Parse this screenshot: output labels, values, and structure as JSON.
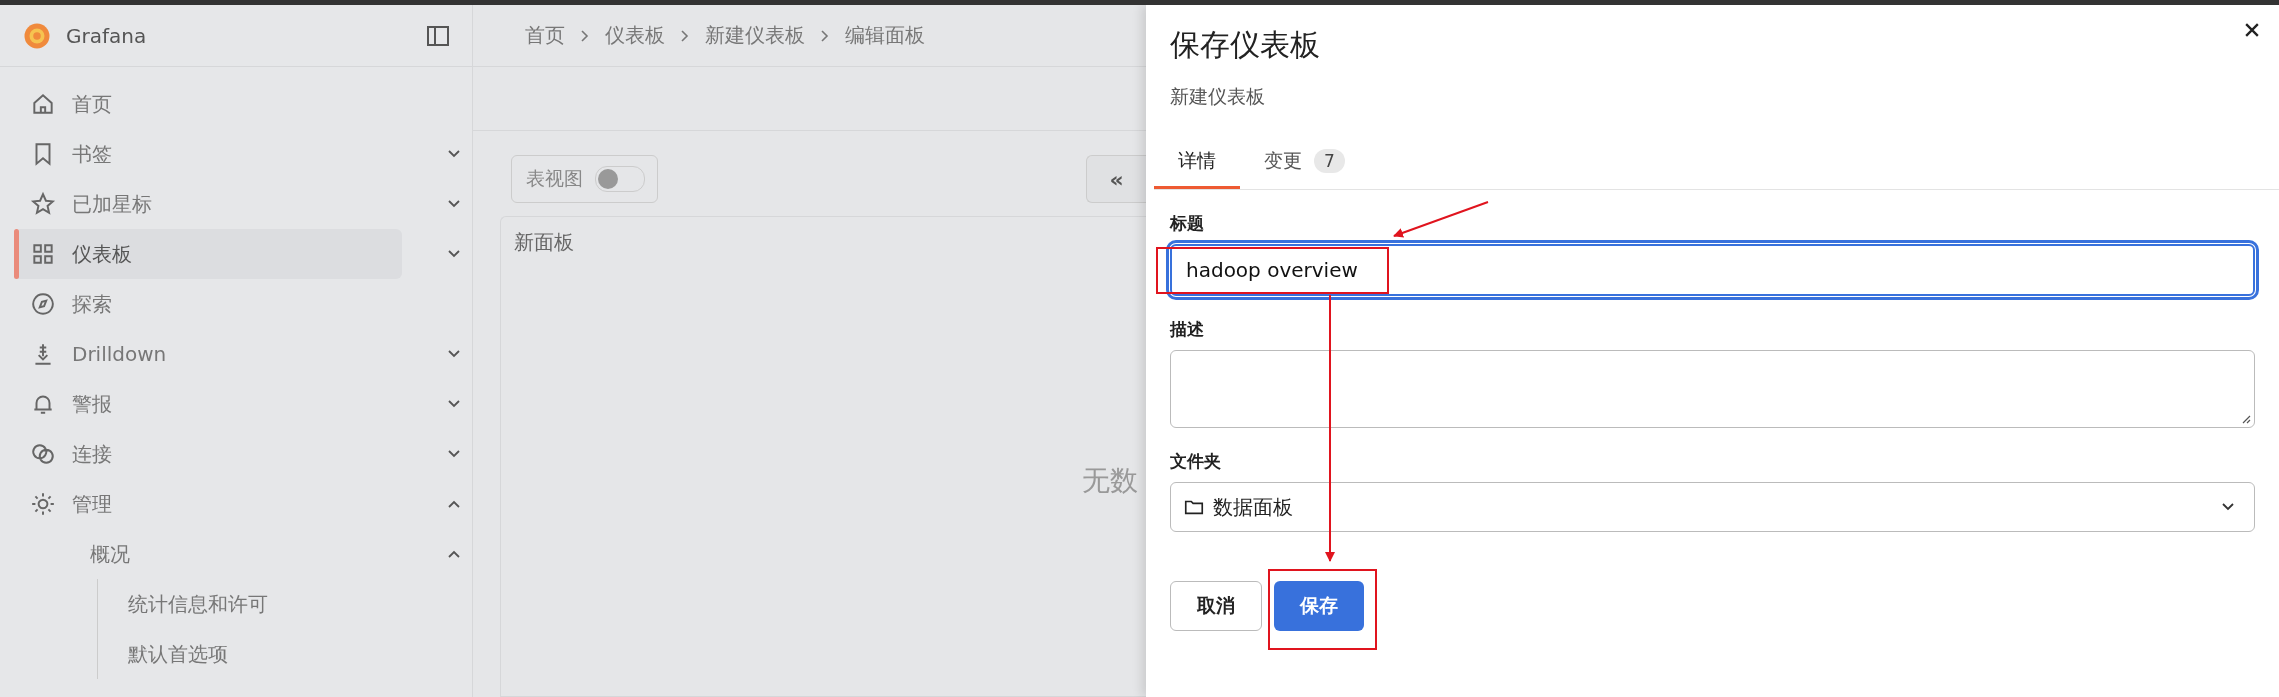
{
  "app": {
    "name": "Grafana"
  },
  "sidebar": {
    "items": [
      {
        "label": "首页",
        "selected": false
      },
      {
        "label": "书签",
        "selected": false,
        "expanded": false
      },
      {
        "label": "已加星标",
        "selected": false,
        "expanded": false
      },
      {
        "label": "仪表板",
        "selected": true,
        "expanded": false
      },
      {
        "label": "探索",
        "selected": false
      },
      {
        "label": "Drilldown",
        "selected": false,
        "expanded": false
      },
      {
        "label": "警报",
        "selected": false,
        "expanded": false
      },
      {
        "label": "连接",
        "selected": false,
        "expanded": false
      },
      {
        "label": "管理",
        "selected": false,
        "expanded": true,
        "children": [
          {
            "label": "概况",
            "selected": false,
            "expanded": true,
            "children": [
              {
                "label": "统计信息和许可",
                "selected": false
              },
              {
                "label": "默认首选项",
                "selected": false
              }
            ]
          }
        ]
      }
    ]
  },
  "breadcrumb": [
    "首页",
    "仪表板",
    "新建仪表板",
    "编辑面板"
  ],
  "toolbar": {
    "table_view": {
      "label": "表视图",
      "on": false
    },
    "collapse_button": "«"
  },
  "panel": {
    "title": "新面板",
    "message": "无数"
  },
  "drawer": {
    "title": "保存仪表板",
    "subtitle": "新建仪表板",
    "tabs": [
      {
        "label": "详情",
        "selected": true
      },
      {
        "label": "变更",
        "badge": "7",
        "selected": false
      }
    ],
    "title_field": {
      "label": "标题",
      "value": "hadoop overview",
      "focused": true
    },
    "description_field": {
      "label": "描述"
    },
    "folder_field": {
      "label": "文件夹",
      "value": "数据面板"
    },
    "buttons": [
      {
        "label": "取消",
        "kind": "secondary"
      },
      {
        "label": "保存",
        "kind": "primary"
      }
    ]
  }
}
